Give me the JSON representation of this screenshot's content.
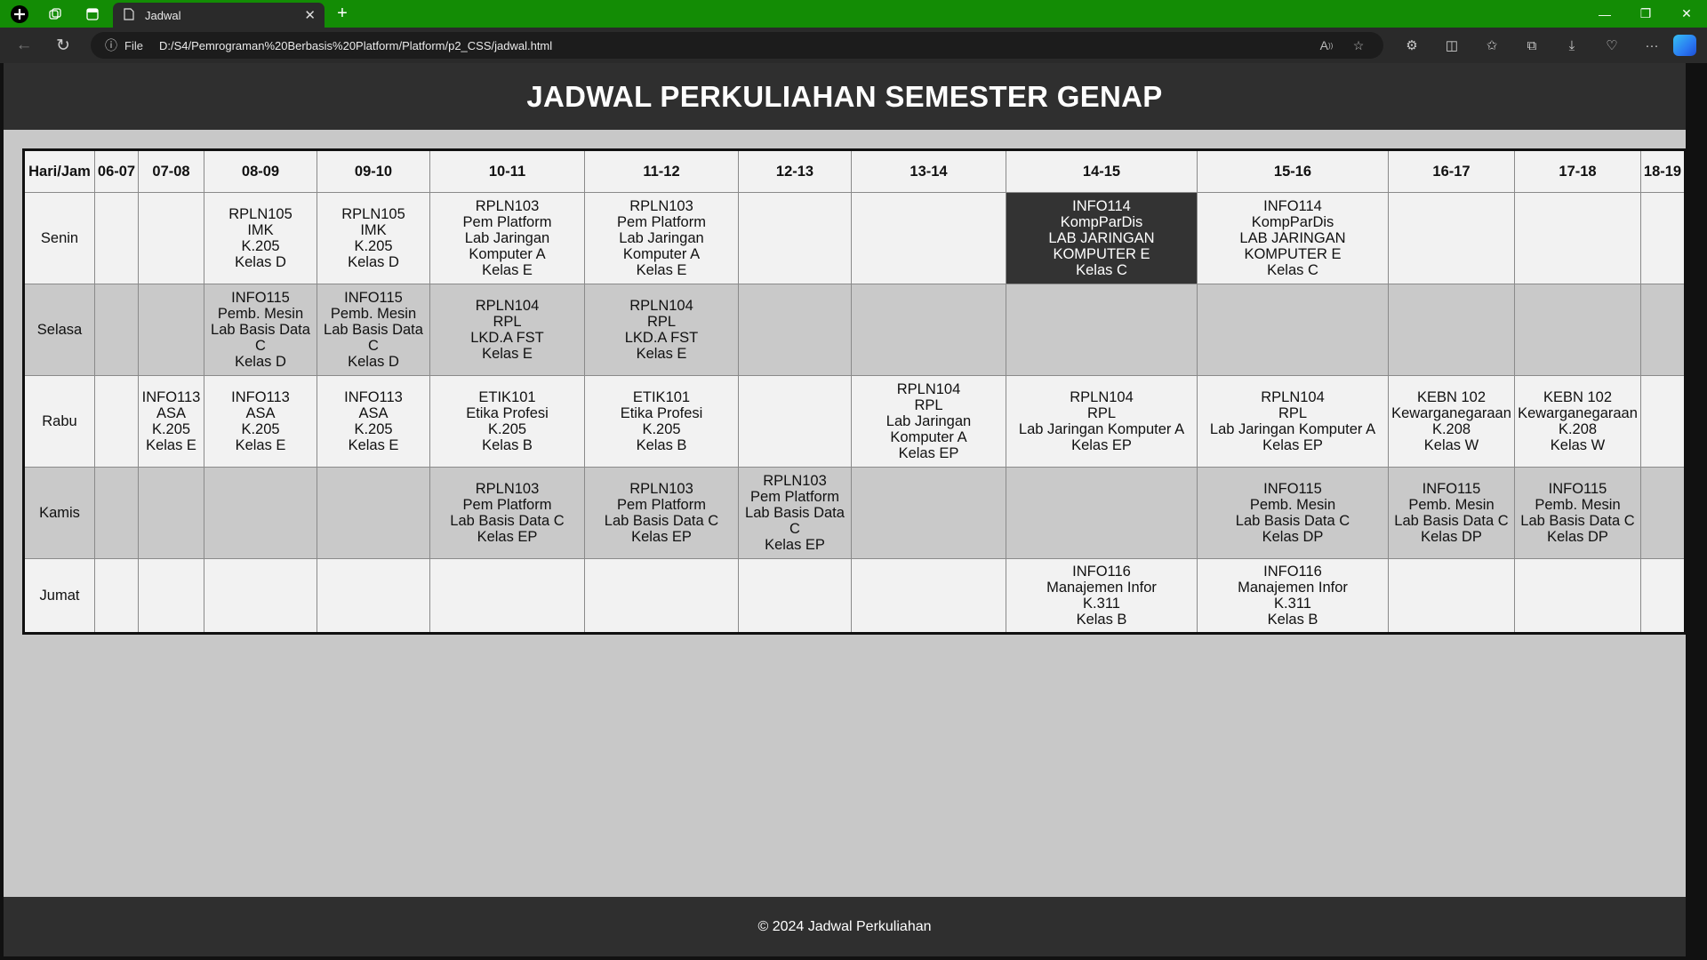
{
  "browser": {
    "tab_title": "Jadwal",
    "address_scheme": "File",
    "url": "D:/S4/Pemrograman%20Berbasis%20Platform/Platform/p2_CSS/jadwal.html",
    "accent_color": "#138c05"
  },
  "page": {
    "title": "JADWAL PERKULIAHAN SEMESTER GENAP",
    "footer": "© 2024 Jadwal Perkuliahan"
  },
  "schedule": {
    "headers": [
      "Hari/Jam",
      "06-07",
      "07-08",
      "08-09",
      "09-10",
      "10-11",
      "11-12",
      "12-13",
      "13-14",
      "14-15",
      "15-16",
      "16-17",
      "17-18",
      "18-19"
    ],
    "rows": [
      {
        "day": "Senin",
        "cells": [
          "",
          "",
          "RPLN105\nIMK\nK.205\nKelas D",
          "RPLN105\nIMK\nK.205\nKelas D",
          "RPLN103\nPem Platform\nLab Jaringan\nKomputer A\nKelas E",
          "RPLN103\nPem Platform\nLab Jaringan\nKomputer A\nKelas E",
          "",
          "",
          "INFO114\nKompParDis\nLAB JARINGAN\nKOMPUTER E\nKelas C",
          "INFO114\nKompParDis\nLAB JARINGAN\nKOMPUTER E\nKelas C",
          "",
          "",
          ""
        ]
      },
      {
        "day": "Selasa",
        "cells": [
          "",
          "",
          "INFO115\nPemb. Mesin\nLab Basis Data\nC\nKelas D",
          "INFO115\nPemb. Mesin\nLab Basis Data\nC\nKelas D",
          "RPLN104\nRPL\nLKD.A FST\nKelas E",
          "RPLN104\nRPL\nLKD.A FST\nKelas E",
          "",
          "",
          "",
          "",
          "",
          "",
          ""
        ]
      },
      {
        "day": "Rabu",
        "cells": [
          "",
          "INFO113\nASA\nK.205\nKelas E",
          "INFO113\nASA\nK.205\nKelas E",
          "INFO113\nASA\nK.205\nKelas E",
          "ETIK101\nEtika Profesi\nK.205\nKelas B",
          "ETIK101\nEtika Profesi\nK.205\nKelas B",
          "",
          "RPLN104\nRPL\nLab Jaringan\nKomputer A\nKelas EP",
          "RPLN104\nRPL\nLab Jaringan Komputer A\nKelas EP",
          "RPLN104\nRPL\nLab Jaringan Komputer A\nKelas EP",
          "KEBN 102\nKewarganegaraan\nK.208\nKelas W",
          "KEBN 102\nKewarganegaraan\nK.208\nKelas W",
          ""
        ]
      },
      {
        "day": "Kamis",
        "cells": [
          "",
          "",
          "",
          "",
          "RPLN103\nPem Platform\nLab Basis Data C\nKelas EP",
          "RPLN103\nPem Platform\nLab Basis Data C\nKelas EP",
          "RPLN103\nPem Platform\nLab Basis Data\nC\nKelas EP",
          "",
          "",
          "INFO115\nPemb. Mesin\nLab Basis Data C\nKelas DP",
          "INFO115\nPemb. Mesin\nLab Basis Data C\nKelas DP",
          "INFO115\nPemb. Mesin\nLab Basis Data C\nKelas DP",
          ""
        ]
      },
      {
        "day": "Jumat",
        "cells": [
          "",
          "",
          "",
          "",
          "",
          "",
          "",
          "",
          "INFO116\nManajemen Infor\nK.311\nKelas B",
          "INFO116\nManajemen Infor\nK.311\nKelas B",
          "",
          "",
          ""
        ]
      }
    ],
    "highlighted_cell": {
      "row": 0,
      "col": 8
    }
  }
}
